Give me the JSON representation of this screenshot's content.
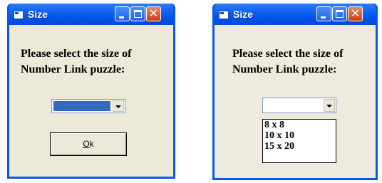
{
  "left_dialog": {
    "title": "Size",
    "prompt": "Please select the size of Number Link puzzle:",
    "combo_value": "",
    "ok_button_prefix": "",
    "ok_button_accel": "O",
    "ok_button_rest": "k"
  },
  "right_dialog": {
    "title": "Size",
    "prompt": "Please select the size of Number Link puzzle:",
    "combo_value": "",
    "options": [
      "8 x 8",
      "10 x 10",
      "15 x 20"
    ]
  },
  "colors": {
    "titlebar": "#0058e6",
    "client_left": "#ece9d8",
    "client_right": "#efeade",
    "selection": "#316ac5",
    "close_button": "#d9522a"
  },
  "icons": [
    "window-app-icon",
    "minimize-icon",
    "maximize-icon",
    "close-icon",
    "dropdown-arrow-icon"
  ]
}
